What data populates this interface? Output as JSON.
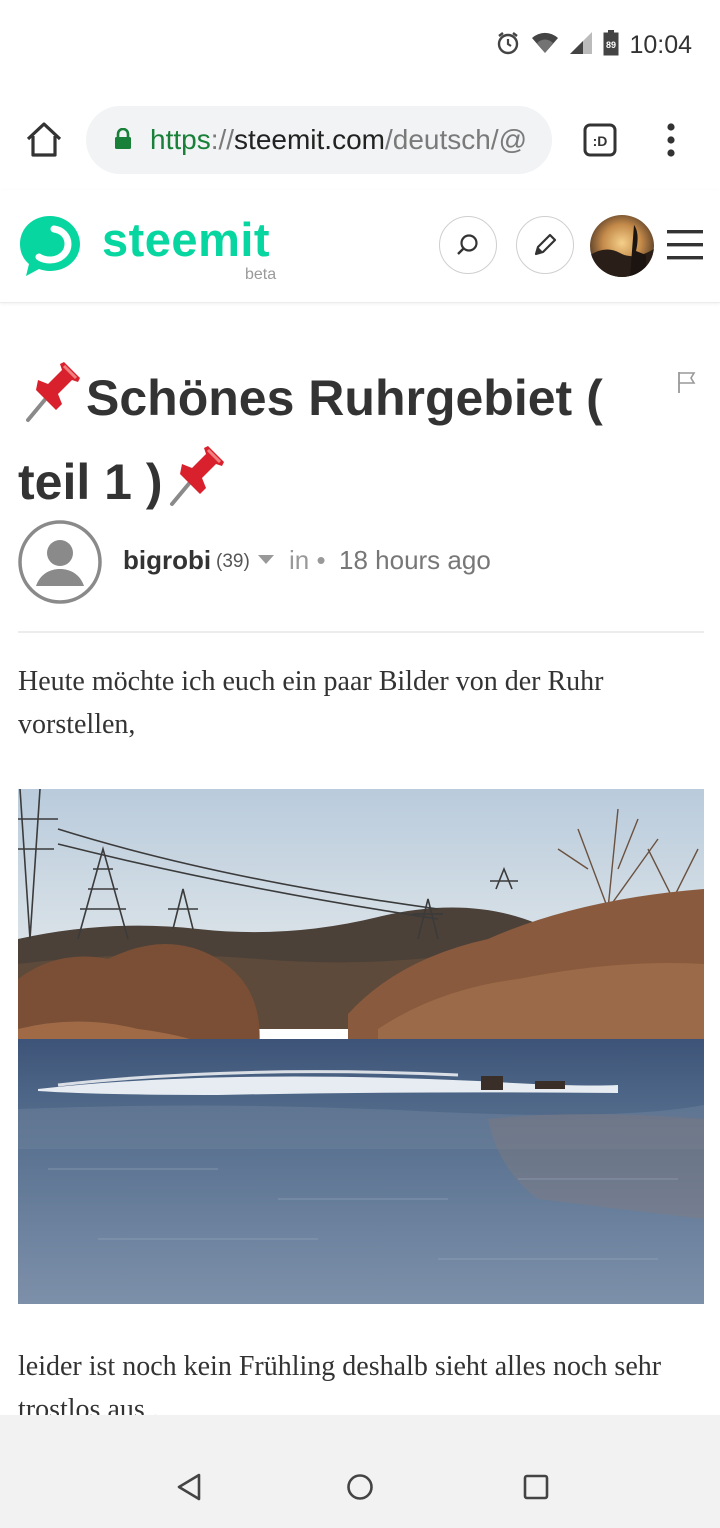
{
  "status": {
    "time": "10:04",
    "battery": "89"
  },
  "browser": {
    "url_scheme": "https",
    "url_separator": "://",
    "url_host": "steemit.com",
    "url_path": "/deutsch/@",
    "tabs_label": ":D"
  },
  "site": {
    "logo_text": "steemit",
    "logo_beta": "beta",
    "brand_color": "#07d6a0"
  },
  "post": {
    "title": "Schönes Ruhrgebiet ( teil 1 )",
    "author": "bigrobi",
    "reputation": "(39)",
    "in_label": "in •",
    "time_ago": "18 hours ago",
    "paragraphs": [
      "Heute möchte ich euch ein paar Bilder von der Ruhr vorstellen,",
      "leider ist noch kein Frühling deshalb sieht alles noch sehr trostlos aus ."
    ]
  },
  "icons": {
    "status": [
      "alarm-icon",
      "wifi-icon",
      "signal-icon",
      "battery-icon"
    ],
    "browser": [
      "home-icon",
      "lock-icon",
      "tabs-icon",
      "overflow-menu-icon"
    ],
    "header": [
      "steemit-logo-icon",
      "search-icon",
      "pencil-icon",
      "user-avatar",
      "hamburger-icon"
    ],
    "post": [
      "pushpin-icon",
      "flag-icon",
      "author-avatar-icon",
      "caret-down-icon"
    ],
    "nav": [
      "back-icon",
      "home-circle-icon",
      "recents-icon"
    ]
  }
}
